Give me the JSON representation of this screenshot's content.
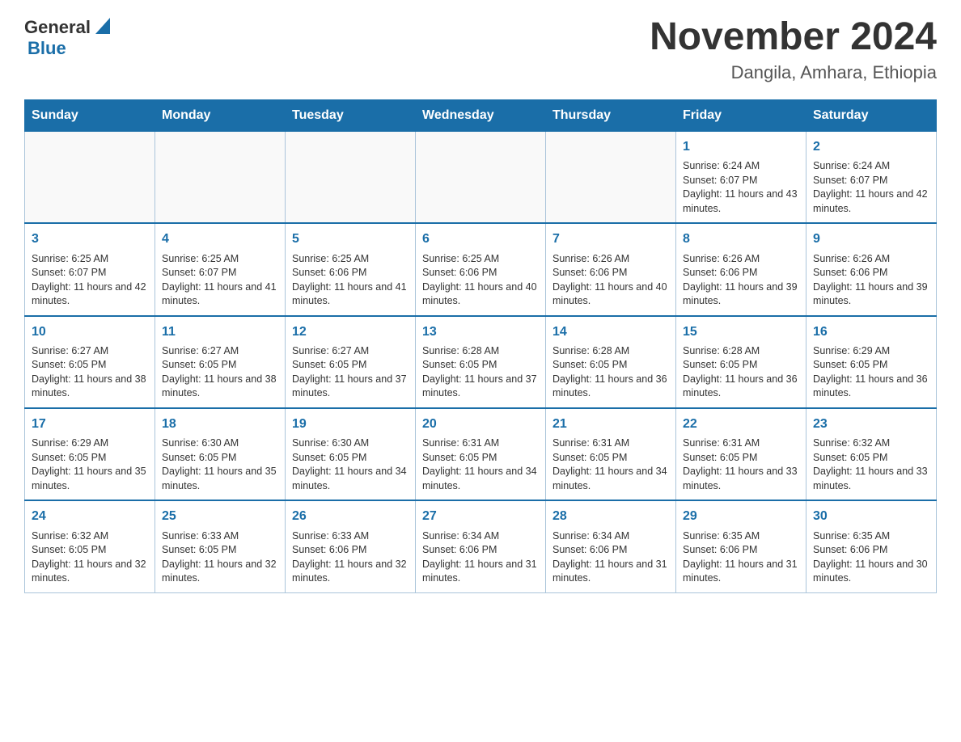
{
  "header": {
    "logo_general": "General",
    "logo_blue": "Blue",
    "month_year": "November 2024",
    "location": "Dangila, Amhara, Ethiopia"
  },
  "weekdays": [
    "Sunday",
    "Monday",
    "Tuesday",
    "Wednesday",
    "Thursday",
    "Friday",
    "Saturday"
  ],
  "weeks": [
    [
      {
        "day": "",
        "info": ""
      },
      {
        "day": "",
        "info": ""
      },
      {
        "day": "",
        "info": ""
      },
      {
        "day": "",
        "info": ""
      },
      {
        "day": "",
        "info": ""
      },
      {
        "day": "1",
        "info": "Sunrise: 6:24 AM\nSunset: 6:07 PM\nDaylight: 11 hours and 43 minutes."
      },
      {
        "day": "2",
        "info": "Sunrise: 6:24 AM\nSunset: 6:07 PM\nDaylight: 11 hours and 42 minutes."
      }
    ],
    [
      {
        "day": "3",
        "info": "Sunrise: 6:25 AM\nSunset: 6:07 PM\nDaylight: 11 hours and 42 minutes."
      },
      {
        "day": "4",
        "info": "Sunrise: 6:25 AM\nSunset: 6:07 PM\nDaylight: 11 hours and 41 minutes."
      },
      {
        "day": "5",
        "info": "Sunrise: 6:25 AM\nSunset: 6:06 PM\nDaylight: 11 hours and 41 minutes."
      },
      {
        "day": "6",
        "info": "Sunrise: 6:25 AM\nSunset: 6:06 PM\nDaylight: 11 hours and 40 minutes."
      },
      {
        "day": "7",
        "info": "Sunrise: 6:26 AM\nSunset: 6:06 PM\nDaylight: 11 hours and 40 minutes."
      },
      {
        "day": "8",
        "info": "Sunrise: 6:26 AM\nSunset: 6:06 PM\nDaylight: 11 hours and 39 minutes."
      },
      {
        "day": "9",
        "info": "Sunrise: 6:26 AM\nSunset: 6:06 PM\nDaylight: 11 hours and 39 minutes."
      }
    ],
    [
      {
        "day": "10",
        "info": "Sunrise: 6:27 AM\nSunset: 6:05 PM\nDaylight: 11 hours and 38 minutes."
      },
      {
        "day": "11",
        "info": "Sunrise: 6:27 AM\nSunset: 6:05 PM\nDaylight: 11 hours and 38 minutes."
      },
      {
        "day": "12",
        "info": "Sunrise: 6:27 AM\nSunset: 6:05 PM\nDaylight: 11 hours and 37 minutes."
      },
      {
        "day": "13",
        "info": "Sunrise: 6:28 AM\nSunset: 6:05 PM\nDaylight: 11 hours and 37 minutes."
      },
      {
        "day": "14",
        "info": "Sunrise: 6:28 AM\nSunset: 6:05 PM\nDaylight: 11 hours and 36 minutes."
      },
      {
        "day": "15",
        "info": "Sunrise: 6:28 AM\nSunset: 6:05 PM\nDaylight: 11 hours and 36 minutes."
      },
      {
        "day": "16",
        "info": "Sunrise: 6:29 AM\nSunset: 6:05 PM\nDaylight: 11 hours and 36 minutes."
      }
    ],
    [
      {
        "day": "17",
        "info": "Sunrise: 6:29 AM\nSunset: 6:05 PM\nDaylight: 11 hours and 35 minutes."
      },
      {
        "day": "18",
        "info": "Sunrise: 6:30 AM\nSunset: 6:05 PM\nDaylight: 11 hours and 35 minutes."
      },
      {
        "day": "19",
        "info": "Sunrise: 6:30 AM\nSunset: 6:05 PM\nDaylight: 11 hours and 34 minutes."
      },
      {
        "day": "20",
        "info": "Sunrise: 6:31 AM\nSunset: 6:05 PM\nDaylight: 11 hours and 34 minutes."
      },
      {
        "day": "21",
        "info": "Sunrise: 6:31 AM\nSunset: 6:05 PM\nDaylight: 11 hours and 34 minutes."
      },
      {
        "day": "22",
        "info": "Sunrise: 6:31 AM\nSunset: 6:05 PM\nDaylight: 11 hours and 33 minutes."
      },
      {
        "day": "23",
        "info": "Sunrise: 6:32 AM\nSunset: 6:05 PM\nDaylight: 11 hours and 33 minutes."
      }
    ],
    [
      {
        "day": "24",
        "info": "Sunrise: 6:32 AM\nSunset: 6:05 PM\nDaylight: 11 hours and 32 minutes."
      },
      {
        "day": "25",
        "info": "Sunrise: 6:33 AM\nSunset: 6:05 PM\nDaylight: 11 hours and 32 minutes."
      },
      {
        "day": "26",
        "info": "Sunrise: 6:33 AM\nSunset: 6:06 PM\nDaylight: 11 hours and 32 minutes."
      },
      {
        "day": "27",
        "info": "Sunrise: 6:34 AM\nSunset: 6:06 PM\nDaylight: 11 hours and 31 minutes."
      },
      {
        "day": "28",
        "info": "Sunrise: 6:34 AM\nSunset: 6:06 PM\nDaylight: 11 hours and 31 minutes."
      },
      {
        "day": "29",
        "info": "Sunrise: 6:35 AM\nSunset: 6:06 PM\nDaylight: 11 hours and 31 minutes."
      },
      {
        "day": "30",
        "info": "Sunrise: 6:35 AM\nSunset: 6:06 PM\nDaylight: 11 hours and 30 minutes."
      }
    ]
  ]
}
